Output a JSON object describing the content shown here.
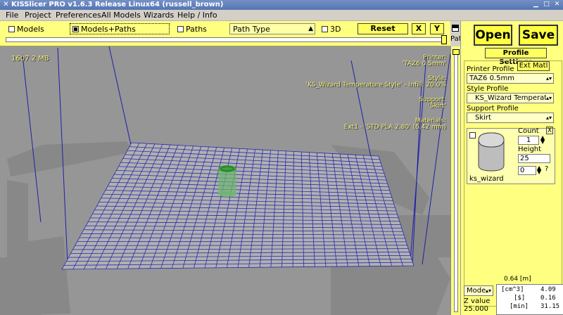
{
  "window": {
    "title": "KISSlicer PRO v1.6.3 Release Linux64 (russell_brown)"
  },
  "menu": [
    "File",
    "Project",
    "Preferences",
    "All Models",
    "Wizards",
    "Help / Info"
  ],
  "toolbar": {
    "models_label": "Models",
    "models_paths_label": "Models+Paths",
    "paths_label": "Paths",
    "path_type": "Path Type",
    "three_d_label": "3D",
    "reset_label": "Reset",
    "x_label": "X",
    "y_label": "Y",
    "path_pct_label": "Path%"
  },
  "viewport": {
    "memory": "1607.2 MB",
    "printer_label": "Printer:",
    "printer_value": "'TAZ6 0.5mm'",
    "style_label": "Style:",
    "style_value": "'KS_Wizard Temperature Style' - Infill: 20.0%",
    "support_label": "Support:",
    "support_value": "'Skirt'",
    "materials_label": "Materials:",
    "materials_value": "Ext1 - 'STD PLA 2.80' (6.42 mm)"
  },
  "panel": {
    "open_label": "Open",
    "save_label": "Save",
    "profile_settings_label": "Profile Settings",
    "ext_matl_label": "Ext Matl",
    "printer_profile_label": "Printer Profile",
    "printer_profile_value": "TAZ6 0.5mm",
    "style_profile_label": "Style Profile",
    "style_profile_value": "KS_Wizard Temperat",
    "support_profile_label": "Support Profile",
    "support_profile_value": "Skirt",
    "count_label": "Count",
    "count_value": "1",
    "height_label": "Height",
    "height_value": "25",
    "ext_value": "0",
    "question_mark": "?",
    "model_name": "ks_wizard",
    "close_x": "X",
    "scale_value": "0.64 [m]",
    "mode_select": "Model",
    "z_label": "Z value",
    "z_value": "25.000",
    "stats": [
      {
        "unit": "[cm^3]",
        "value": "4.09"
      },
      {
        "unit": "[$]",
        "value": "0.16"
      },
      {
        "unit": "[min]",
        "value": "31.15"
      }
    ]
  },
  "colors": {
    "panel_bg": "#ffff80",
    "viewport_bg": "#969696",
    "grid": "#2a2ab0",
    "text_overlay": "#f0ef7a"
  }
}
